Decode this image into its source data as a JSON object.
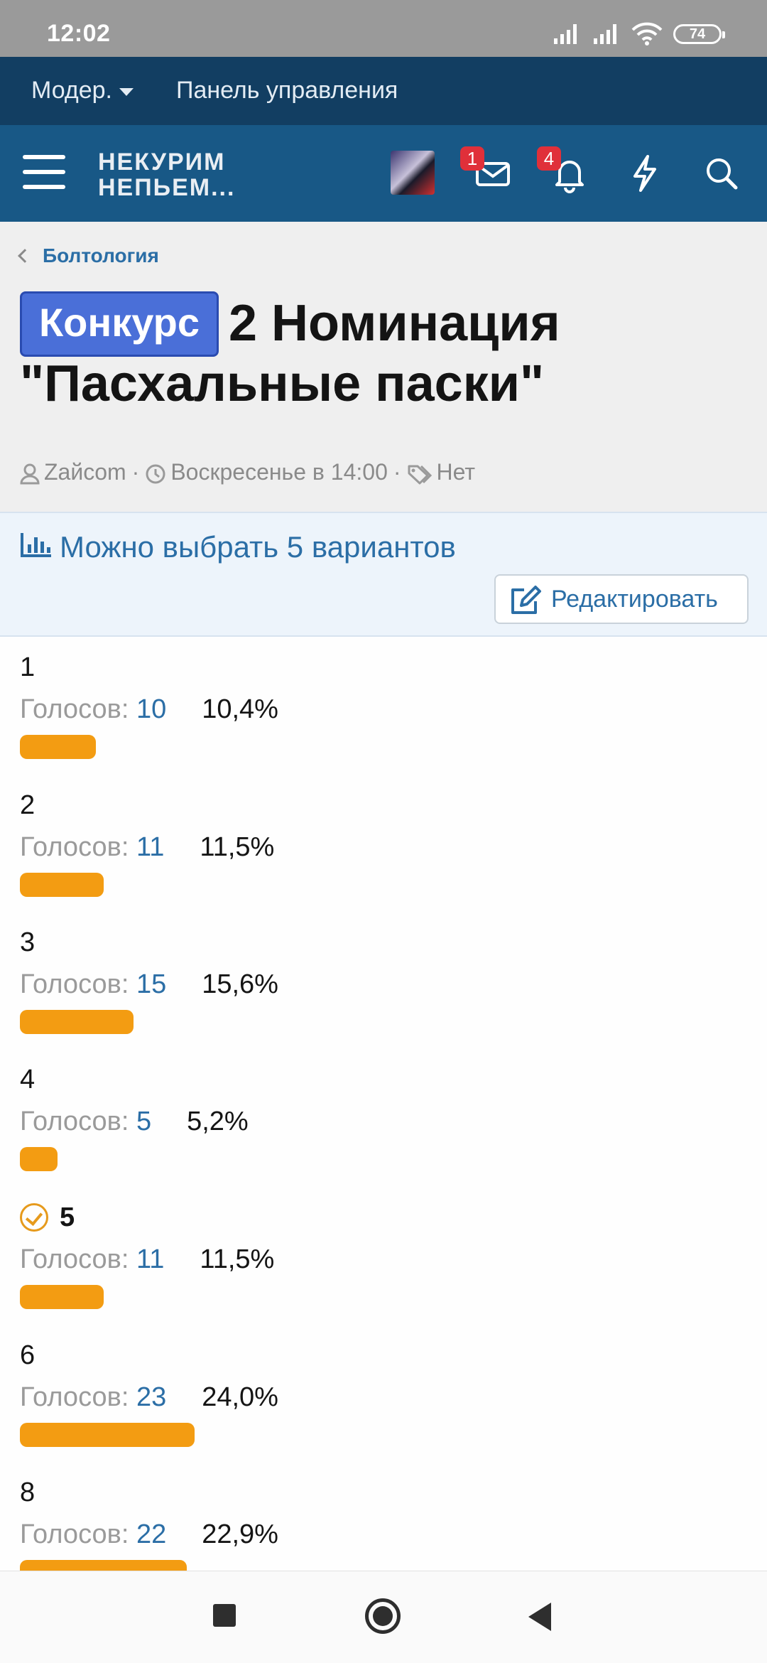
{
  "status_bar": {
    "time": "12:02",
    "battery": "74"
  },
  "mod_bar": {
    "moderation_label": "Модер.",
    "control_panel_label": "Панель управления"
  },
  "header": {
    "logo_line1": "НЕКУРИМ",
    "logo_line2": "НЕПЬЕМ...",
    "messages_badge": "1",
    "alerts_badge": "4"
  },
  "thread": {
    "breadcrumb": "Болтология",
    "prefix": "Конкурс",
    "title": "2 Номинация \"Пасхальные паски\"",
    "author": "Zайcom",
    "date": "Воскресенье в 14:00",
    "tags": "Нет"
  },
  "poll": {
    "question": "Можно выбрать 5 вариантов",
    "edit_label": "Редактировать",
    "votes_label": "Голосов:",
    "results": [
      {
        "label": "1",
        "votes": "10",
        "percent": "10,4%",
        "share": 10.4,
        "voted": false
      },
      {
        "label": "2",
        "votes": "11",
        "percent": "11,5%",
        "share": 11.5,
        "voted": false
      },
      {
        "label": "3",
        "votes": "15",
        "percent": "15,6%",
        "share": 15.6,
        "voted": false
      },
      {
        "label": "4",
        "votes": "5",
        "percent": "5,2%",
        "share": 5.2,
        "voted": false
      },
      {
        "label": "5",
        "votes": "11",
        "percent": "11,5%",
        "share": 11.5,
        "voted": true
      },
      {
        "label": "6",
        "votes": "23",
        "percent": "24,0%",
        "share": 24.0,
        "voted": false
      },
      {
        "label": "8",
        "votes": "22",
        "percent": "22,9%",
        "share": 22.9,
        "voted": false
      }
    ],
    "bar_color": "#f39c12"
  },
  "colors": {
    "mod_bar": "#123e62",
    "header": "#185886",
    "link": "#2b6ea6",
    "prefix_tag": "#4a6fd8"
  }
}
